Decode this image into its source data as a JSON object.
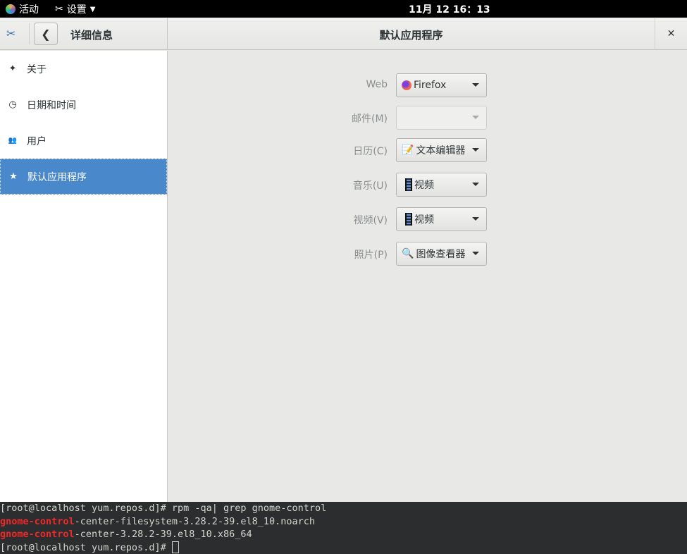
{
  "topbar": {
    "activities": "活动",
    "app_menu": "设置",
    "clock": "11月 12  16：13"
  },
  "header": {
    "left_title": "详细信息",
    "main_title": "默认应用程序"
  },
  "sidebar": {
    "items": [
      {
        "label": "关于",
        "icon": "sparkle-icon"
      },
      {
        "label": "日期和时间",
        "icon": "clock-icon"
      },
      {
        "label": "用户",
        "icon": "users-icon"
      },
      {
        "label": "默认应用程序",
        "icon": "star-icon",
        "selected": true
      }
    ]
  },
  "defaults": [
    {
      "label": "Web",
      "value": "Firefox",
      "icon": "firefox-icon"
    },
    {
      "label": "邮件(M)",
      "value": "",
      "disabled": true
    },
    {
      "label": "日历(C)",
      "value": "文本编辑器",
      "icon": "text-editor-icon"
    },
    {
      "label": "音乐(U)",
      "value": "视频",
      "icon": "film-icon"
    },
    {
      "label": "视频(V)",
      "value": "视频",
      "icon": "film-icon"
    },
    {
      "label": "照片(P)",
      "value": "图像查看器",
      "icon": "image-viewer-icon"
    }
  ],
  "terminal": {
    "line1": "[root@localhost yum.repos.d]# rpm -qa| grep gnome-control",
    "line2_match": "gnome-control",
    "line2_rest": "-center-filesystem-3.28.2-39.el8_10.noarch",
    "line3_match": "gnome-control",
    "line3_rest": "-center-3.28.2-39.el8_10.x86_64",
    "line4": "[root@localhost yum.repos.d]# "
  },
  "colors": {
    "selection": "#4a88cc",
    "terminal_bg": "#2b2d2e",
    "match": "#ef2929"
  }
}
